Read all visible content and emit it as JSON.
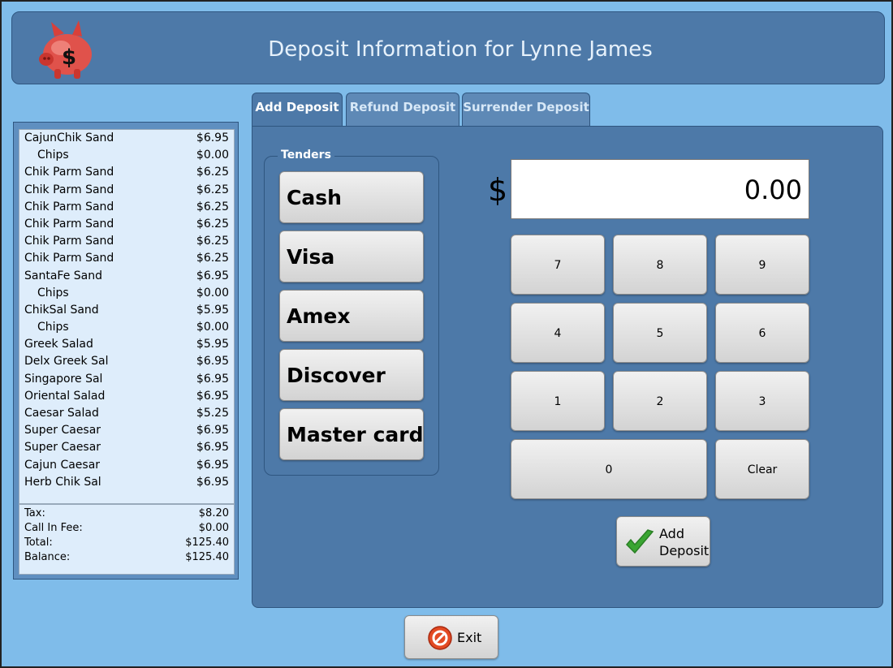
{
  "header": {
    "title": "Deposit Information for Lynne James"
  },
  "order": {
    "items": [
      {
        "name": "CajunChik Sand",
        "price": "$6.95",
        "sub": false
      },
      {
        "name": "Chips",
        "price": "$0.00",
        "sub": true
      },
      {
        "name": "Chik Parm Sand",
        "price": "$6.25",
        "sub": false
      },
      {
        "name": "Chik Parm Sand",
        "price": "$6.25",
        "sub": false
      },
      {
        "name": "Chik Parm Sand",
        "price": "$6.25",
        "sub": false
      },
      {
        "name": "Chik Parm Sand",
        "price": "$6.25",
        "sub": false
      },
      {
        "name": "Chik Parm Sand",
        "price": "$6.25",
        "sub": false
      },
      {
        "name": "Chik Parm Sand",
        "price": "$6.25",
        "sub": false
      },
      {
        "name": "SantaFe Sand",
        "price": "$6.95",
        "sub": false
      },
      {
        "name": "Chips",
        "price": "$0.00",
        "sub": true
      },
      {
        "name": "ChikSal Sand",
        "price": "$5.95",
        "sub": false
      },
      {
        "name": "Chips",
        "price": "$0.00",
        "sub": true
      },
      {
        "name": "Greek Salad",
        "price": "$5.95",
        "sub": false
      },
      {
        "name": "Delx Greek Sal",
        "price": "$6.95",
        "sub": false
      },
      {
        "name": "Singapore Sal",
        "price": "$6.95",
        "sub": false
      },
      {
        "name": "Oriental Salad",
        "price": "$6.95",
        "sub": false
      },
      {
        "name": "Caesar Salad",
        "price": "$5.25",
        "sub": false
      },
      {
        "name": "Super Caesar",
        "price": "$6.95",
        "sub": false
      },
      {
        "name": "Super Caesar",
        "price": "$6.95",
        "sub": false
      },
      {
        "name": "Cajun Caesar",
        "price": "$6.95",
        "sub": false
      },
      {
        "name": "Herb Chik Sal",
        "price": "$6.95",
        "sub": false
      }
    ],
    "totals": [
      {
        "label": "Tax:",
        "value": "$8.20"
      },
      {
        "label": "Call In Fee:",
        "value": "$0.00"
      },
      {
        "label": "Total:",
        "value": "$125.40"
      },
      {
        "label": "Balance:",
        "value": "$125.40"
      }
    ]
  },
  "tabs": [
    {
      "label": "Add Deposit",
      "active": true
    },
    {
      "label": "Refund Deposit",
      "active": false
    },
    {
      "label": "Surrender Deposit",
      "active": false
    }
  ],
  "tenders": {
    "group_label": "Tenders",
    "buttons": [
      "Cash",
      "Visa",
      "Amex",
      "Discover",
      "Master card"
    ]
  },
  "amount": {
    "currency_symbol": "$",
    "value": "0.00"
  },
  "keypad": {
    "k7": "7",
    "k8": "8",
    "k9": "9",
    "k4": "4",
    "k5": "5",
    "k6": "6",
    "k1": "1",
    "k2": "2",
    "k3": "3",
    "k0": "0",
    "clear": "Clear"
  },
  "add_deposit_button": {
    "line1": "Add",
    "line2": "Deposit"
  },
  "exit_button": {
    "label": "Exit"
  },
  "colors": {
    "background": "#7fbcea",
    "panel": "#4d79a8",
    "header_text": "#e6f1fb"
  }
}
